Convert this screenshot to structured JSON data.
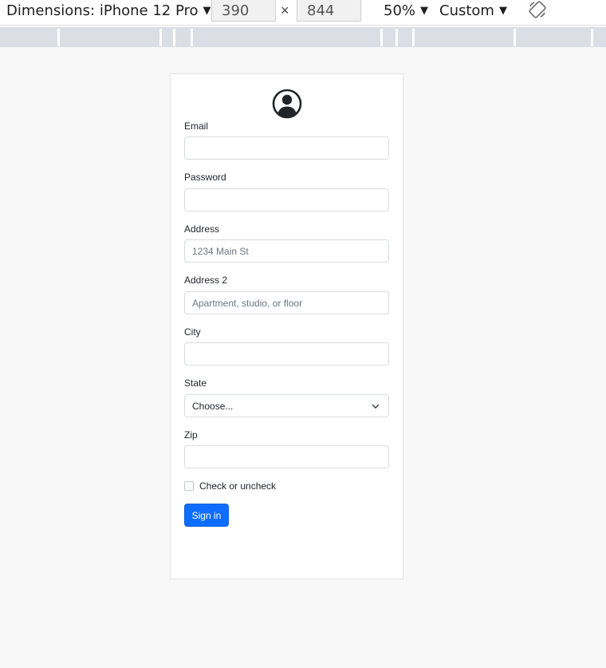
{
  "toolbar": {
    "dimensions_label": "Dimensions: iPhone 12 Pro",
    "width_value": "390",
    "times": "×",
    "height_value": "844",
    "zoom": "50%",
    "throttle": "Custom",
    "caret": "▼",
    "rotate_icon": "rotate-icon"
  },
  "form": {
    "avatar_icon": "person-circle-icon",
    "fields": [
      {
        "label": "Email",
        "value": "",
        "placeholder": ""
      },
      {
        "label": "Password",
        "value": "",
        "placeholder": ""
      },
      {
        "label": "Address",
        "value": "",
        "placeholder": "1234 Main St"
      },
      {
        "label": "Address 2",
        "value": "",
        "placeholder": "Apartment, studio, or floor"
      },
      {
        "label": "City",
        "value": "",
        "placeholder": ""
      },
      {
        "label": "State",
        "value": "Choose...",
        "placeholder": ""
      },
      {
        "label": "Zip",
        "value": "",
        "placeholder": ""
      }
    ],
    "checkbox_label": "Check or uncheck",
    "submit_label": "Sign in"
  },
  "colors": {
    "primary": "#0d6efd",
    "page_bg": "#f8f8f8"
  }
}
